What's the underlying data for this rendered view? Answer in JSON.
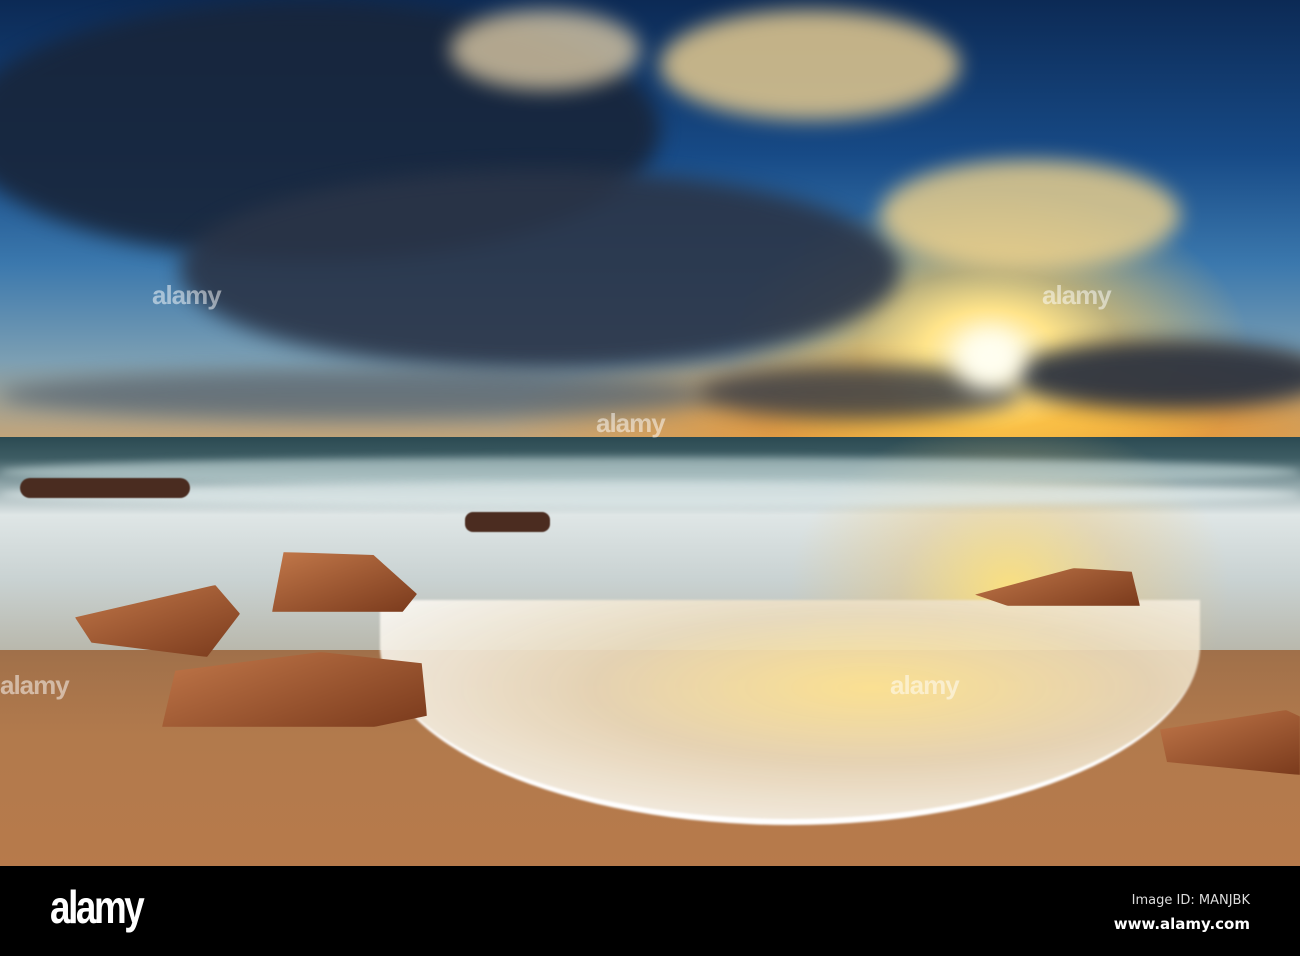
{
  "watermark": {
    "text": "alamy"
  },
  "footer": {
    "logo": "alamy",
    "image_id": "Image ID: MANJBK",
    "url": "www.alamy.com"
  },
  "colors": {
    "sky_top": "#0c2a55",
    "sun": "#ffe48a",
    "sand": "#b27a4c",
    "footer": "#000000"
  }
}
